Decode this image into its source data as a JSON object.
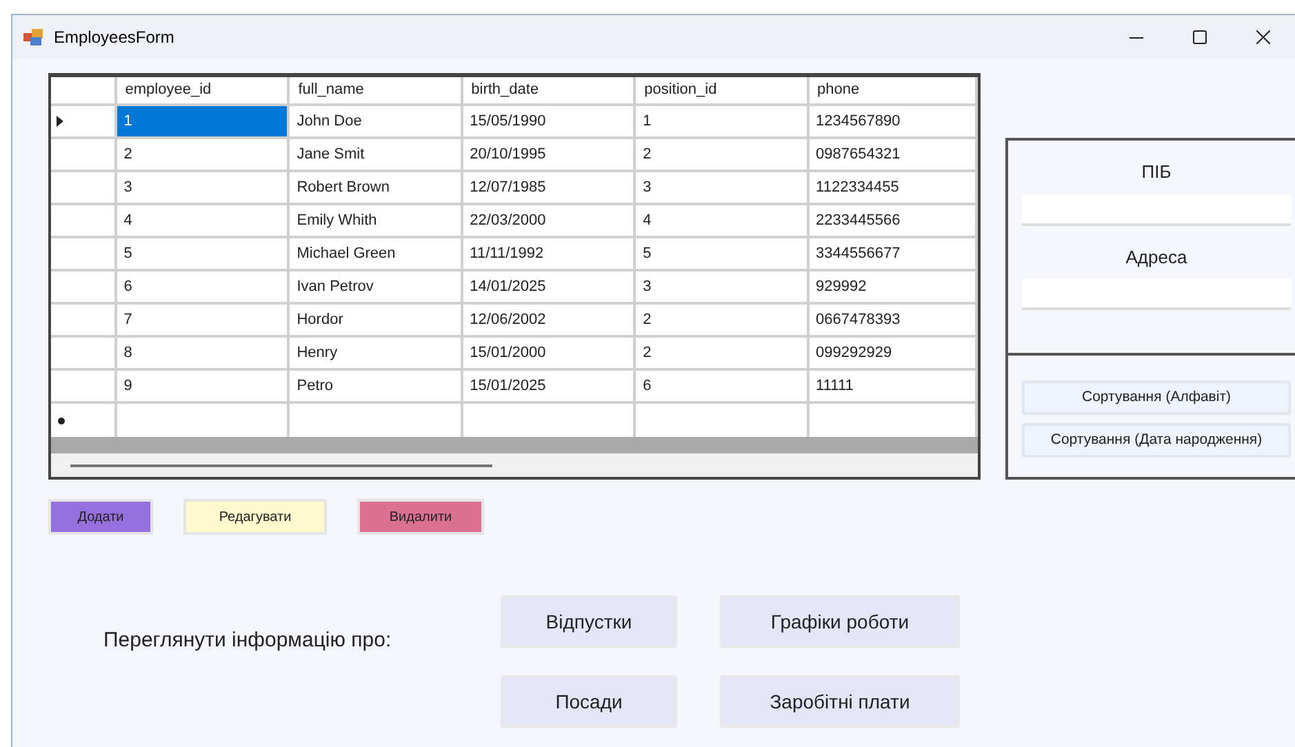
{
  "window": {
    "title": "EmployeesForm"
  },
  "table": {
    "columns": [
      "employee_id",
      "full_name",
      "birth_date",
      "position_id",
      "phone"
    ],
    "rows": [
      {
        "selected": true,
        "cells": [
          "1",
          "John Doe",
          "15/05/1990",
          "1",
          "1234567890"
        ]
      },
      {
        "selected": false,
        "cells": [
          "2",
          "Jane Smit",
          "20/10/1995",
          "2",
          "0987654321"
        ]
      },
      {
        "selected": false,
        "cells": [
          "3",
          "Robert Brown",
          "12/07/1985",
          "3",
          "1122334455"
        ]
      },
      {
        "selected": false,
        "cells": [
          "4",
          "Emily Whith",
          "22/03/2000",
          "4",
          "2233445566"
        ]
      },
      {
        "selected": false,
        "cells": [
          "5",
          "Michael Green",
          "11/11/1992",
          "5",
          "3344556677"
        ]
      },
      {
        "selected": false,
        "cells": [
          "6",
          "Ivan Petrov",
          "14/01/2025",
          "3",
          "929992"
        ]
      },
      {
        "selected": false,
        "cells": [
          "7",
          "Hordor",
          "12/06/2002",
          "2",
          "0667478393"
        ]
      },
      {
        "selected": false,
        "cells": [
          "8",
          "Henry",
          "15/01/2000",
          "2",
          "099292929"
        ]
      },
      {
        "selected": false,
        "cells": [
          "9",
          "Petro",
          "15/01/2025",
          "6",
          "11111"
        ]
      }
    ]
  },
  "actions": [
    {
      "label": "Додати",
      "color": "#9370db"
    },
    {
      "label": "Редагувати",
      "color": "#fffacd"
    },
    {
      "label": "Видалити",
      "color": "#db7093"
    }
  ],
  "filter_panel": {
    "fields": [
      {
        "label": "ПІБ"
      },
      {
        "label": "Адреса"
      }
    ],
    "sort_buttons": [
      "Сортування (Алфавіт)",
      "Сортування (Дата народження)"
    ]
  },
  "view_info": {
    "label": "Переглянути інформацію про:",
    "buttons": [
      "Відпустки",
      "Графіки роботи",
      "Посади",
      "Заробітні плати"
    ]
  }
}
